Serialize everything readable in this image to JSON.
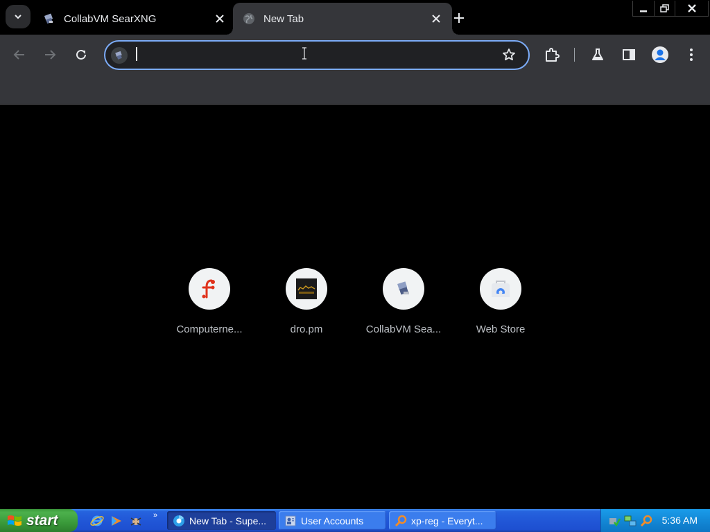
{
  "tabs": [
    {
      "title": "CollabVM SearXNG",
      "active": false
    },
    {
      "title": "New Tab",
      "active": true
    }
  ],
  "omnibox": {
    "value": "",
    "placeholder": ""
  },
  "tiles": [
    {
      "label": "Computerne...",
      "icon": "computernewb-icon"
    },
    {
      "label": "dro.pm",
      "icon": "dro-pm-icon"
    },
    {
      "label": "CollabVM Sea...",
      "icon": "collabvm-icon"
    },
    {
      "label": "Web Store",
      "icon": "web-store-icon"
    }
  ],
  "taskbar": {
    "start_label": "start",
    "tasks": [
      {
        "label": "New Tab - Supe...",
        "active": true,
        "icon": "chromium-icon"
      },
      {
        "label": "User Accounts",
        "active": false,
        "icon": "user-accounts-icon"
      },
      {
        "label": "xp-reg - Everyt...",
        "active": false,
        "icon": "everything-search-icon"
      }
    ],
    "clock": "5:36 AM"
  },
  "colors": {
    "tab_bar": "#000000",
    "toolbar": "#35363a",
    "omnibox_focus": "#7cacf8",
    "taskbar_blue": "#245edb",
    "start_green": "#3c9b3c"
  }
}
